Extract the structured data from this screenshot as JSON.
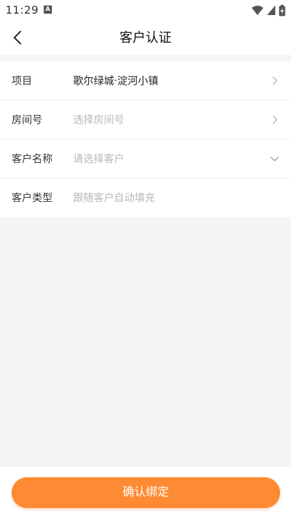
{
  "status_bar": {
    "time": "11:29",
    "notification_icon": "A"
  },
  "header": {
    "title": "客户认证",
    "back_icon": "chevron-left-icon"
  },
  "form": {
    "rows": [
      {
        "label": "项目",
        "value": "歌尔绿城·淀河小镇",
        "placeholder": "",
        "arrow": "chevron-right-icon"
      },
      {
        "label": "房间号",
        "value": "",
        "placeholder": "选择房间号",
        "arrow": "chevron-right-icon"
      },
      {
        "label": "客户名称",
        "value": "",
        "placeholder": "请选择客户",
        "arrow": "chevron-down-icon"
      },
      {
        "label": "客户类型",
        "value": "",
        "placeholder": "跟随客户自动填充",
        "arrow": ""
      }
    ]
  },
  "footer": {
    "confirm_label": "确认绑定"
  },
  "colors": {
    "accent": "#fe8a33",
    "background": "#f4f5f4",
    "placeholder": "#b8b8b8"
  }
}
